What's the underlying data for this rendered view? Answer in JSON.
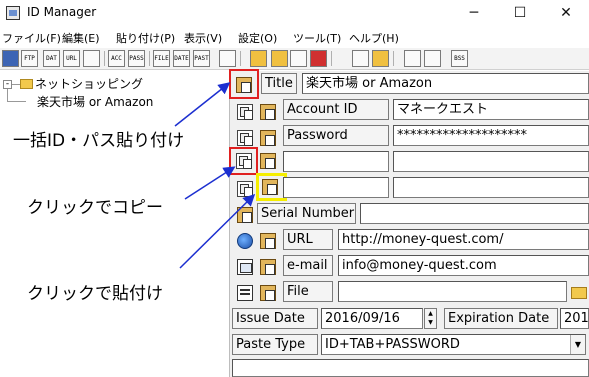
{
  "window": {
    "title": "ID Manager",
    "minimize": "─",
    "maximize": "☐",
    "close": "✕"
  },
  "menu": [
    "ファイル(F)",
    "編集(E)",
    "貼り付け(P)",
    "表示(V)",
    "設定(O)",
    "ツール(T)",
    "ヘルプ(H)"
  ],
  "toolbar": {
    "ftp_label": "FTP",
    "dat_label": "DAT",
    "url_label": "URL",
    "acc_label": "ACC",
    "pass_label": "PASS",
    "file_label": "FILE",
    "date_label": "DATE",
    "past_label": "PAST",
    "bss_label": "BSS"
  },
  "tree": {
    "root_label": "ネットショッピング",
    "child_label": "楽天市場 or Amazon",
    "expander": "-"
  },
  "fields": {
    "title_label": "Title",
    "title_value": "楽天市場 or Amazon",
    "account_label": "Account ID",
    "account_value": "マネークエスト",
    "password_label": "Password",
    "password_value": "********************",
    "blank1_label": "",
    "blank1_value": "",
    "blank2_label": "",
    "blank2_value": "",
    "serial_label": "Serial Number",
    "serial_value": "",
    "url_label": "URL",
    "url_value": "http://money-quest.com/",
    "email_label": "e-mail",
    "email_value": "info@money-quest.com",
    "file_label": "File",
    "file_value": "",
    "issue_label": "Issue Date",
    "issue_value": "2016/09/16",
    "expiration_label": "Expiration Date",
    "expiration_value": "201",
    "paste_label": "Paste Type",
    "paste_value": "ID+TAB+PASSWORD"
  },
  "annotations": {
    "paste_all": "一括ID・パス貼り付け",
    "copy": "クリックでコピー",
    "paste": "クリックで貼付け"
  },
  "colors": {
    "highlight_red": "#e02020",
    "highlight_yellow": "#f5ee00",
    "arrow_blue": "#1c2fd0"
  }
}
